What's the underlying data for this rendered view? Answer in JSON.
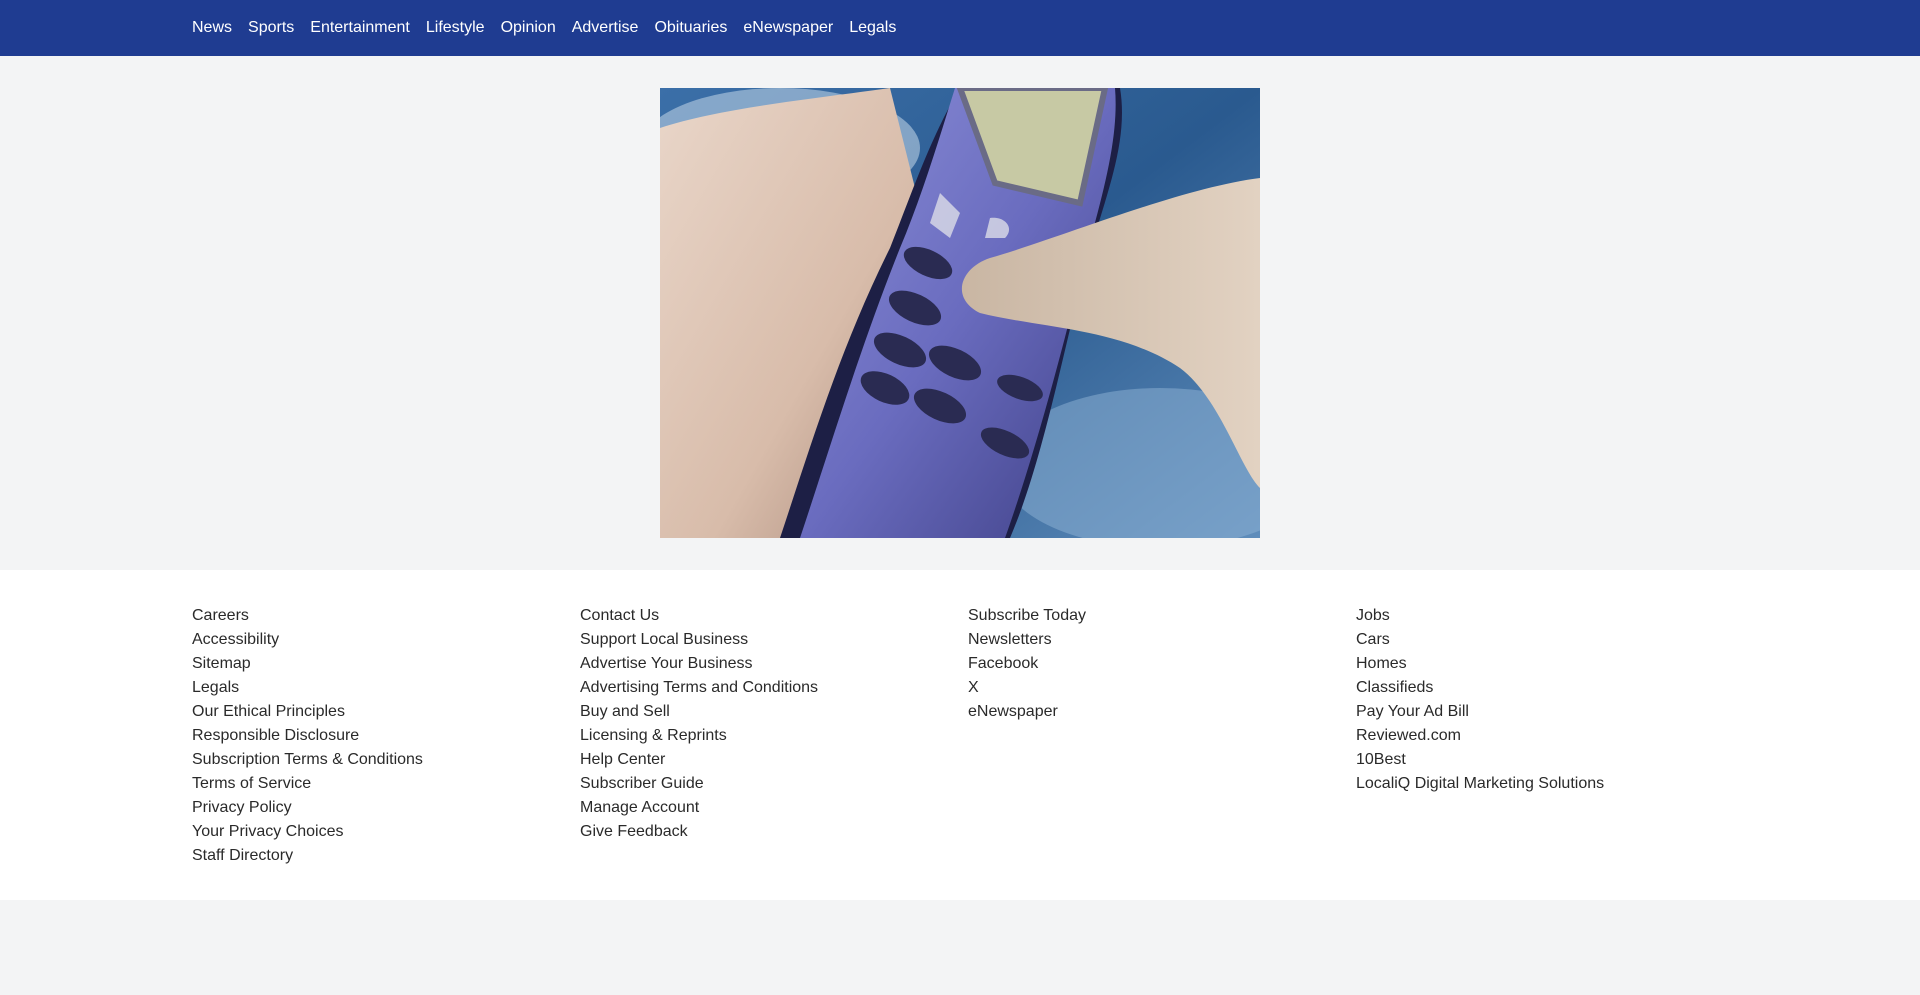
{
  "nav": {
    "items": [
      "News",
      "Sports",
      "Entertainment",
      "Lifestyle",
      "Opinion",
      "Advertise",
      "Obituaries",
      "eNewspaper",
      "Legals"
    ]
  },
  "hero": {
    "image": "photo of a hand pressing keys on a purple mobile phone against a blue sky"
  },
  "footer": {
    "col1": [
      "Careers",
      "Accessibility",
      "Sitemap",
      "Legals",
      "Our Ethical Principles",
      "Responsible Disclosure",
      "Subscription Terms & Conditions",
      "Terms of Service",
      "Privacy Policy",
      "Your Privacy Choices",
      "Staff Directory"
    ],
    "col2": [
      "Contact Us",
      "Support Local Business",
      "Advertise Your Business",
      "Advertising Terms and Conditions",
      "Buy and Sell",
      "Licensing & Reprints",
      "Help Center",
      "Subscriber Guide",
      "Manage Account",
      "Give Feedback"
    ],
    "col3": [
      "Subscribe Today",
      "Newsletters",
      "Facebook",
      "X",
      "eNewspaper"
    ],
    "col4": [
      "Jobs",
      "Cars",
      "Homes",
      "Classifieds",
      "Pay Your Ad Bill",
      "Reviewed.com",
      "10Best",
      "LocaliQ Digital Marketing Solutions"
    ]
  },
  "colors": {
    "nav_bg": "#1f3c91",
    "page_bg": "#f3f4f5",
    "footer_bg": "#ffffff",
    "link_text": "#2a2a2a"
  }
}
